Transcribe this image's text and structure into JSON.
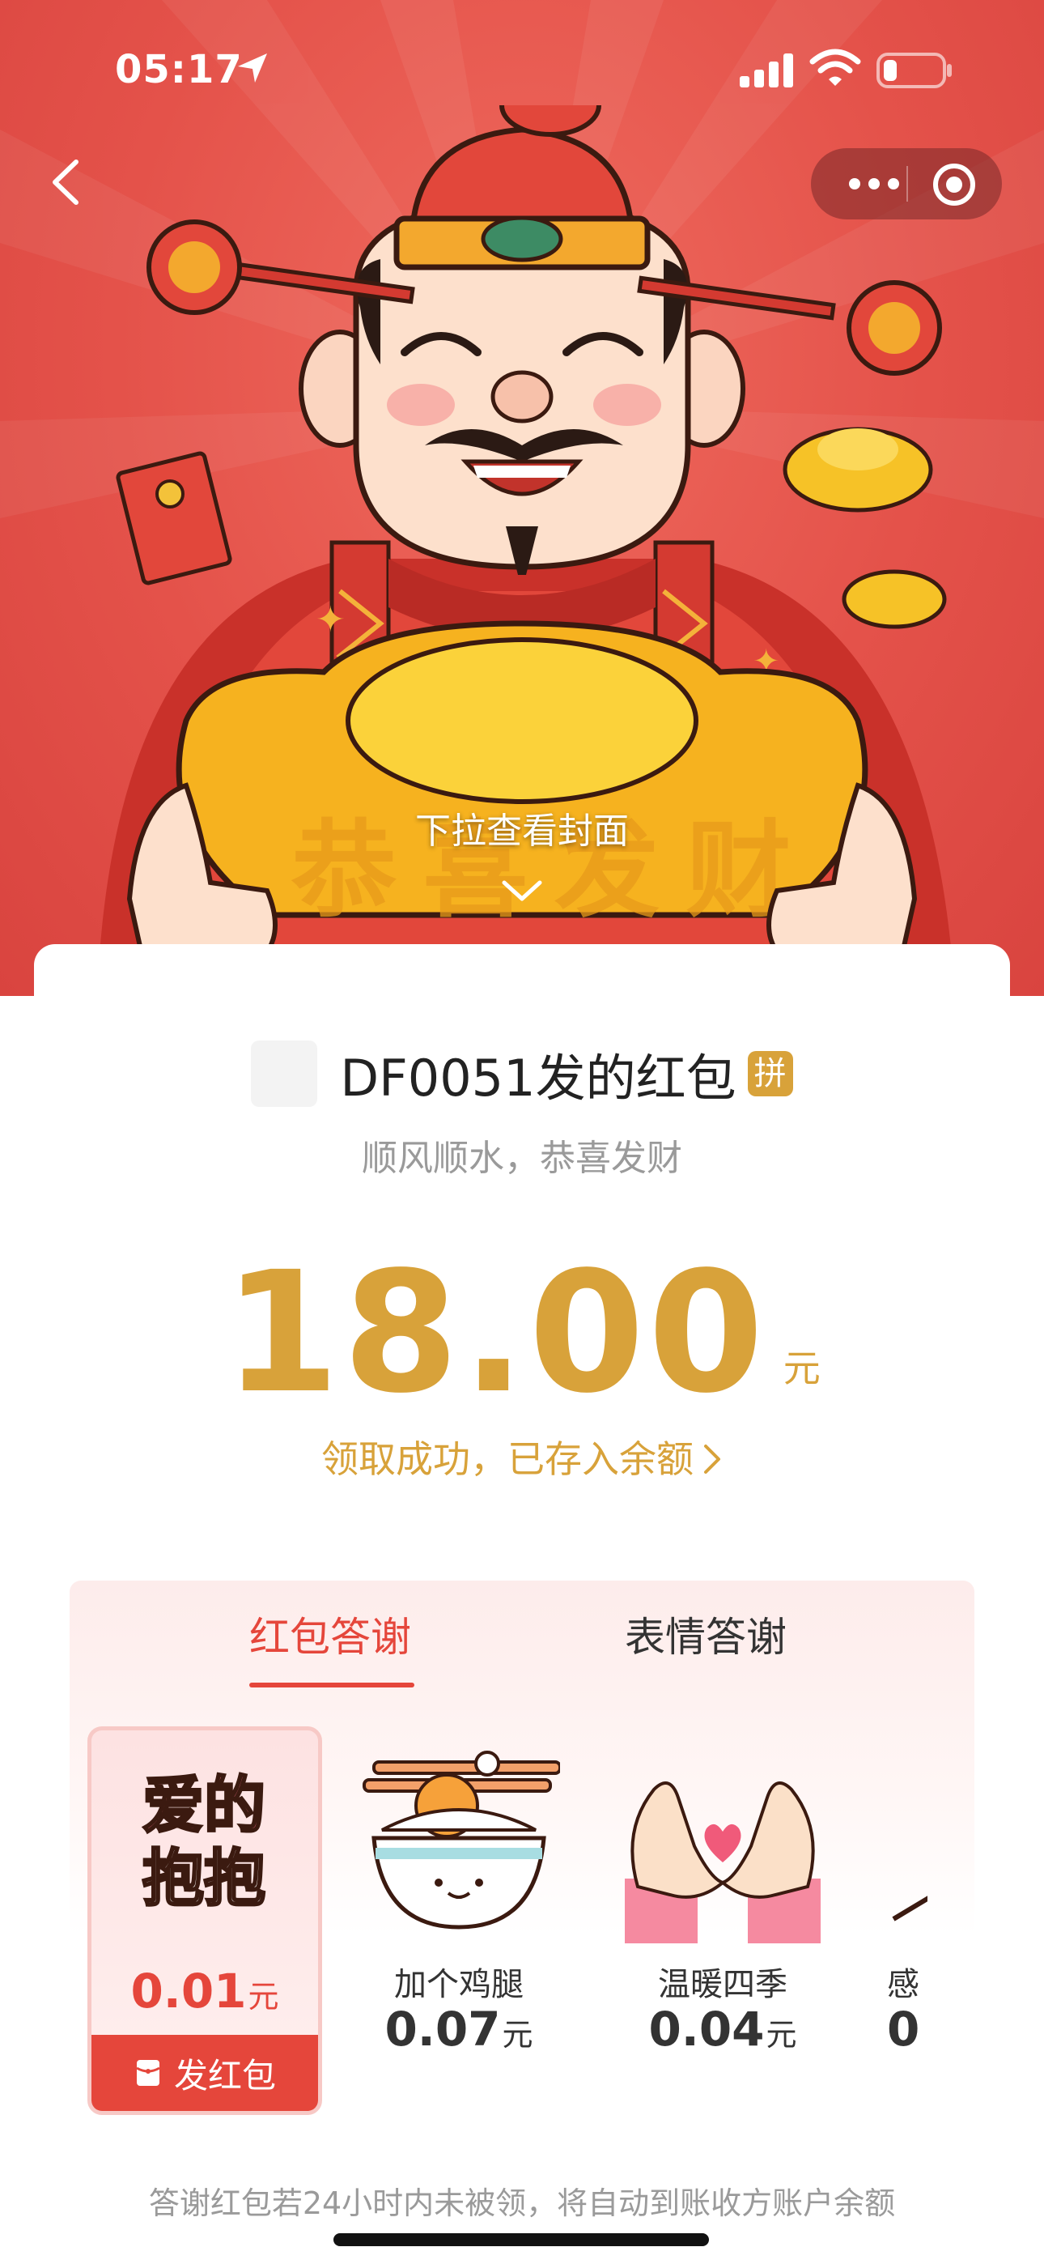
{
  "status_bar": {
    "time": "05:17"
  },
  "nav": {
    "back_label": "",
    "more_label": "",
    "target_label": ""
  },
  "cover": {
    "pull_hint": "下拉查看封面"
  },
  "packet": {
    "sender": "DF0051发的红包",
    "badge": "拼",
    "wish": "顺风顺水，恭喜发财",
    "amount": "18.00",
    "unit": "元",
    "status": "领取成功，已存入余额"
  },
  "thanks": {
    "tabs": [
      {
        "label": "红包答谢",
        "active": true
      },
      {
        "label": "表情答谢",
        "active": false
      }
    ],
    "gifts": [
      {
        "name": "爱的抱抱",
        "price": "0.01",
        "unit": "元",
        "selected": true,
        "art_text_1": "爱的",
        "art_text_2": "抱抱"
      },
      {
        "name": "加个鸡腿",
        "price": "0.07",
        "unit": "元",
        "selected": false
      },
      {
        "name": "温暖四季",
        "price": "0.04",
        "unit": "元",
        "selected": false
      },
      {
        "name": "感",
        "price": "0",
        "unit": "",
        "selected": false
      }
    ],
    "send_button": "发红包",
    "note": "答谢红包若24小时内未被领，将自动到账收方账户余额"
  },
  "colors": {
    "accent_red": "#e5463b",
    "gold": "#d8a23a",
    "cover_red": "#e4524a"
  }
}
